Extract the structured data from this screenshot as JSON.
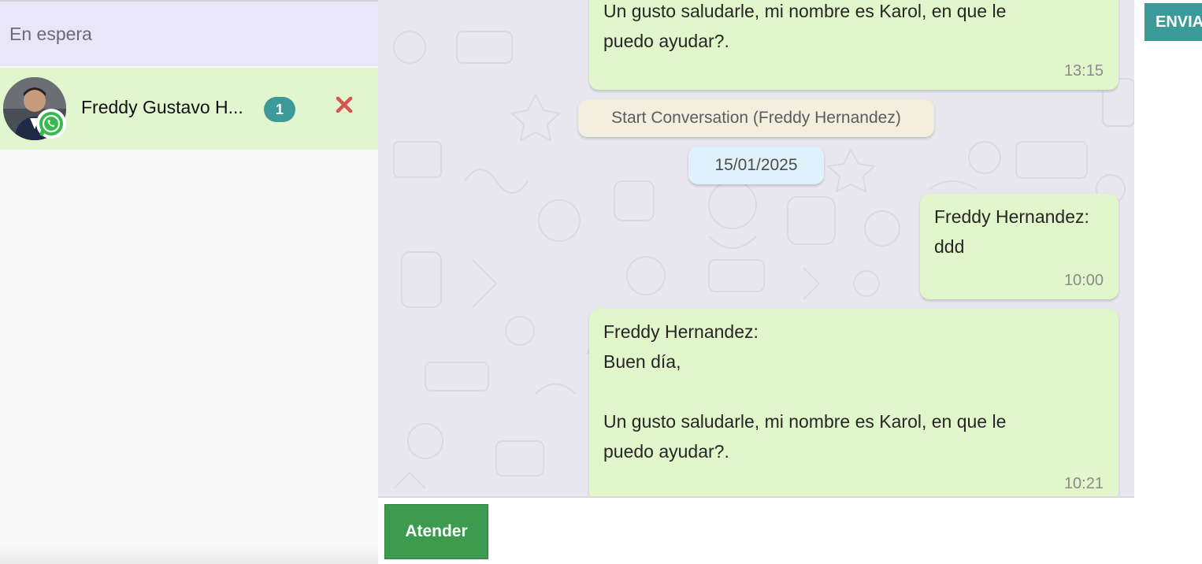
{
  "queue": {
    "section_title": "En espera",
    "contact": {
      "name": "Freddy Gustavo H...",
      "unread_count": "1",
      "channel_icon": "whatsapp-icon",
      "close_icon": "close-icon"
    }
  },
  "chat": {
    "messages_top": {
      "text": "Un gusto saludarle, mi nombre es Karol, en que le\npuedo ayudar?.",
      "time": "13:15"
    },
    "system_event": "Start Conversation (Freddy Hernandez)",
    "date_separator": "15/01/2025",
    "message_short": {
      "text": "Freddy Hernandez:\nddd",
      "time": "10:00"
    },
    "message_long": {
      "text": "Freddy Hernandez:\nBuen día,\n\nUn gusto saludarle, mi nombre es Karol, en que le\npuedo ayudar?.",
      "time": "10:21"
    },
    "attend_button": "Atender"
  },
  "toolbar": {
    "send_button": "ENVIAR"
  },
  "colors": {
    "accent_teal": "#3c9a98",
    "attend_green": "#3d9b4f",
    "bubble_green": "#e1f6cb",
    "queue_header": "#e8e6f8",
    "delete_red": "#d9534f"
  }
}
